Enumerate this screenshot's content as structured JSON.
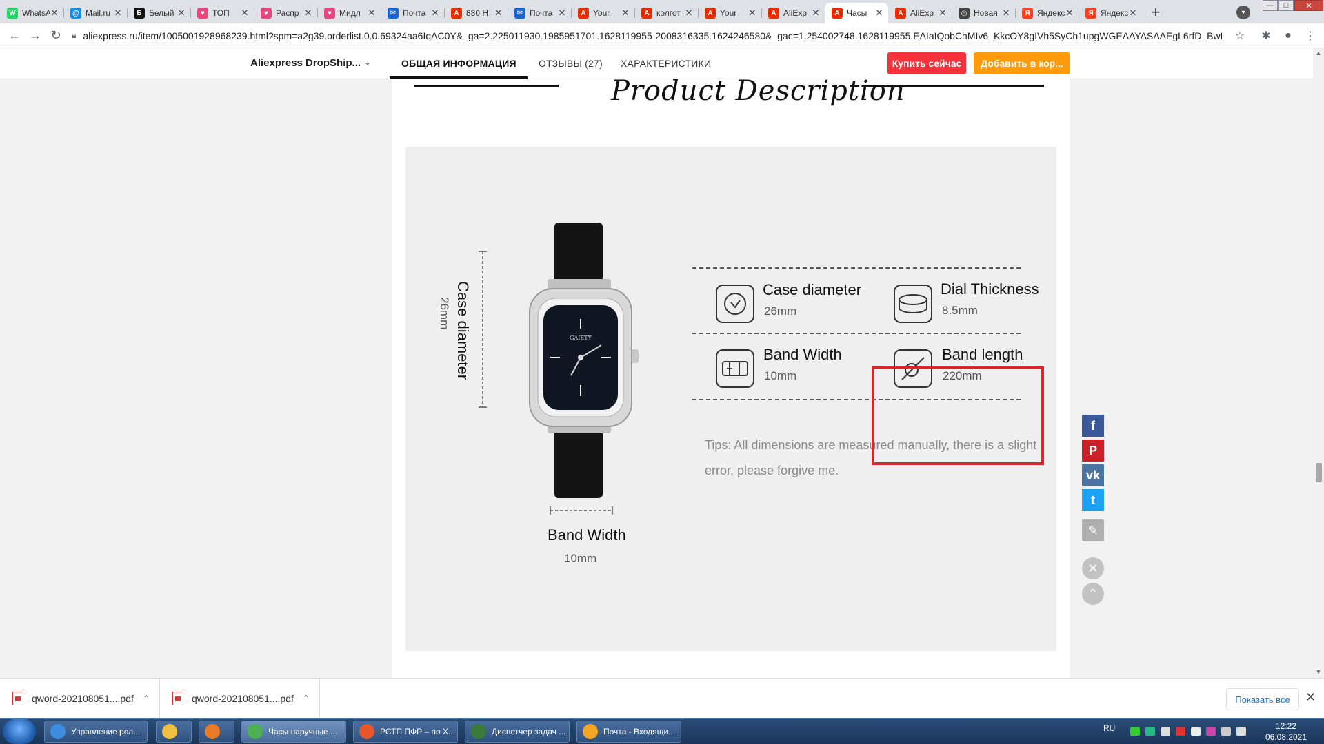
{
  "browser": {
    "tabs": [
      {
        "title": "WhatsApp",
        "color": "#25d366",
        "glyph": "W"
      },
      {
        "title": "Mail.ru",
        "color": "#168de2",
        "glyph": "@"
      },
      {
        "title": "Белый",
        "color": "#111111",
        "glyph": "Б"
      },
      {
        "title": "ТОП",
        "color": "#e8487e",
        "glyph": "♥"
      },
      {
        "title": "Распр",
        "color": "#e8487e",
        "glyph": "♥"
      },
      {
        "title": "Мидл",
        "color": "#e8487e",
        "glyph": "♥"
      },
      {
        "title": "Почта",
        "color": "#1a64d6",
        "glyph": "✉"
      },
      {
        "title": "880 H",
        "color": "#e62e04",
        "glyph": "A"
      },
      {
        "title": "Почта",
        "color": "#1a64d6",
        "glyph": "✉"
      },
      {
        "title": "Your",
        "color": "#e62e04",
        "glyph": "A"
      },
      {
        "title": "колгот",
        "color": "#e62e04",
        "glyph": "A"
      },
      {
        "title": "Your",
        "color": "#e62e04",
        "glyph": "A"
      },
      {
        "title": "AliExp",
        "color": "#e62e04",
        "glyph": "A"
      },
      {
        "title": "Часы",
        "color": "#e62e04",
        "glyph": "A",
        "active": true
      },
      {
        "title": "AliExp",
        "color": "#e62e04",
        "glyph": "A"
      },
      {
        "title": "Новая",
        "color": "#444444",
        "glyph": "◎"
      },
      {
        "title": "Яндекс",
        "color": "#fc3f1d",
        "glyph": "Я"
      },
      {
        "title": "Яндекс",
        "color": "#fc3f1d",
        "glyph": "Я"
      }
    ],
    "close_glyph": "✕",
    "new_tab_glyph": "+",
    "url": "aliexpress.ru/item/1005001928968239.html?spm=a2g39.orderlist.0.0.69324aa6IqAC0Y&_ga=2.225011930.1985951701.1628119955-2008316335.1624246580&_gac=1.254002748.1628119955.EAIaIQobChMIv6_KkcOY8gIVh5SyCh1upgWGEAAYASAAEgL6rfD_BwE"
  },
  "sticky_header": {
    "store_name": "Aliexpress DropShip...",
    "tabs": [
      "ОБЩАЯ ИНФОРМАЦИЯ",
      "ОТЗЫВЫ (27)",
      "ХАРАКТЕРИСТИКИ"
    ],
    "buy_now": "Купить сейчас",
    "add_to_cart": "Добавить в кор..."
  },
  "description": {
    "heading": "Product Description",
    "watch_brand": "GAIETY",
    "vertical_label": "Case diameter",
    "vertical_value": "26mm",
    "bottom_label": "Band Width",
    "bottom_value": "10mm",
    "specs": [
      {
        "title": "Case diameter",
        "value": "26mm",
        "icon": "clock-icon"
      },
      {
        "title": "Dial Thickness",
        "value": "8.5mm",
        "icon": "dial-thickness-icon"
      },
      {
        "title": "Band Width",
        "value": "10mm",
        "icon": "band-width-icon"
      },
      {
        "title": "Band length",
        "value": "220mm",
        "icon": "band-length-icon"
      }
    ],
    "tips": "Tips: All dimensions are measured manually, there is a slight error, please forgive me."
  },
  "social": [
    {
      "name": "facebook",
      "glyph": "f",
      "color": "#3b5998"
    },
    {
      "name": "pinterest",
      "glyph": "P",
      "color": "#cb2027"
    },
    {
      "name": "vk",
      "glyph": "vk",
      "color": "#4c75a3"
    },
    {
      "name": "twitter",
      "glyph": "t",
      "color": "#1da1f2"
    }
  ],
  "downloads": {
    "items": [
      "qword-202108051....pdf",
      "qword-202108051....pdf"
    ],
    "show_all": "Показать все"
  },
  "taskbar": {
    "tasks": [
      {
        "label": "Управление рол...",
        "color": "#3d8ee0"
      },
      {
        "label": "",
        "color": "#f0c040"
      },
      {
        "label": "",
        "color": "#e87a2a"
      },
      {
        "label": "Часы наручные ...",
        "color": "#4caf50",
        "active": true
      },
      {
        "label": "РСТП ПФР – по Х...",
        "color": "#e8562a"
      },
      {
        "label": "Диспетчер задач ...",
        "color": "#3a7a3a"
      },
      {
        "label": "Почта - Входящи...",
        "color": "#f5a623"
      }
    ],
    "lang": "RU",
    "time": "12:22",
    "date": "06.08.2021"
  }
}
